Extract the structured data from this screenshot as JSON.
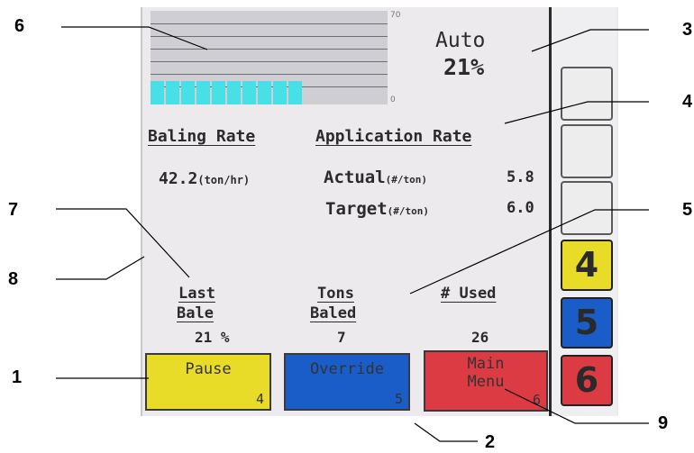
{
  "status": {
    "mode": "Auto",
    "percent": "21%"
  },
  "gauge": {
    "max_label": "70",
    "min_label": "0",
    "fill_fraction": 0.29
  },
  "baling_rate": {
    "heading": "Baling Rate",
    "value": "42.2",
    "unit": "(ton/hr)"
  },
  "application_rate": {
    "heading": "Application Rate",
    "actual_label": "Actual",
    "actual_unit": "(#/ton)",
    "actual_value": "5.8",
    "target_label": "Target",
    "target_unit": "(#/ton)",
    "target_value": "6.0"
  },
  "totals": {
    "last_bale_line1": "Last",
    "last_bale_line2": "Bale",
    "last_bale_value": "21 %",
    "tons_baled_line1": "Tons",
    "tons_baled_line2": "Baled",
    "tons_baled_value": "7",
    "used_label": "# Used",
    "used_value": "26"
  },
  "softkeys": {
    "pause_label": "Pause",
    "pause_num": "4",
    "override_label": "Override",
    "override_num": "5",
    "main_line1": "Main",
    "main_line2": "Menu",
    "main_num": "6"
  },
  "side_keys": [
    "4",
    "5",
    "6"
  ],
  "colors": {
    "yellow": "#e8dc28",
    "blue": "#1a5cc8",
    "red": "#dd3b44",
    "cyan": "#46e0e6"
  },
  "callouts": {
    "c1": "1",
    "c2": "2",
    "c3": "3",
    "c4": "4",
    "c5": "5",
    "c6": "6",
    "c7": "7",
    "c8": "8",
    "c9": "9"
  }
}
